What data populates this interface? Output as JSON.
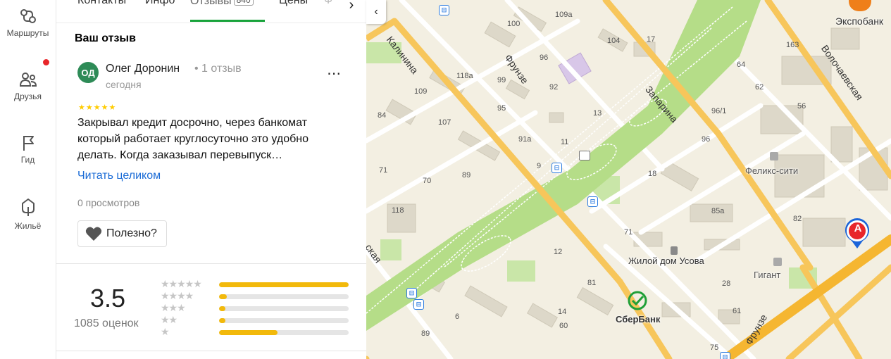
{
  "rail": {
    "items": [
      {
        "label": "Маршруты",
        "icon": "routes-icon"
      },
      {
        "label": "Друзья",
        "icon": "friends-icon"
      },
      {
        "label": "Гид",
        "icon": "guide-flag-icon"
      },
      {
        "label": "Жильё",
        "icon": "housing-icon"
      }
    ]
  },
  "tabs": {
    "items": [
      {
        "label": "Контакты"
      },
      {
        "label": "Инфо"
      },
      {
        "label": "Отзывы",
        "badge": "840",
        "active": true
      },
      {
        "label": "Цены"
      },
      {
        "label": "Ф"
      }
    ],
    "next_icon": "›"
  },
  "review": {
    "section_title": "Ваш отзыв",
    "avatar_initials": "ОД",
    "author": "Олег Доронин",
    "author_meta": "• 1 отзыв",
    "date": "сегодня",
    "more": "⋯",
    "stars": "★★★★★",
    "text": "Закрывал кредит досрочно, через банкомат который работает круглосуточно это удобно делать. Когда заказывал перевыпуск…",
    "read_more": "Читать целиком",
    "views": "0 просмотров",
    "useful": "Полезно?"
  },
  "rating": {
    "value": "3.5",
    "count": "1085 оценок",
    "distribution": [
      {
        "stars": "★★★★★",
        "fraction": 1.0
      },
      {
        "stars": "★★★★",
        "fraction": 0.06
      },
      {
        "stars": "★★★",
        "fraction": 0.05
      },
      {
        "stars": "★★",
        "fraction": 0.05
      },
      {
        "stars": "★",
        "fraction": 0.45
      }
    ]
  },
  "map": {
    "collapse_icon": "‹",
    "streets": [
      "Калинина",
      "Фрунзе",
      "Запарина",
      "Волочаевская",
      "Фрунзе",
      "ская"
    ],
    "house_numbers": [
      "100",
      "109а",
      "104",
      "163",
      "118а",
      "96",
      "99",
      "92",
      "17",
      "64",
      "62",
      "109",
      "95",
      "13",
      "96/1",
      "56",
      "84",
      "107",
      "91а",
      "11",
      "9",
      "96",
      "71",
      "89",
      "70",
      "18",
      "118",
      "85а",
      "82",
      "12",
      "71",
      "14",
      "81",
      "61",
      "28",
      "60",
      "6",
      "89",
      "75"
    ],
    "poi": [
      "Экспобанк",
      "Феликс-сити",
      "Жилой дом Усова",
      "Гигант",
      "СберБанк"
    ],
    "marker_letter": "A",
    "colors": {
      "park": "#b5dd88",
      "road_major": "#f7c65b",
      "road_minor": "#ffffff",
      "block": "#ddd8c9",
      "marker": "#e8262a"
    }
  }
}
